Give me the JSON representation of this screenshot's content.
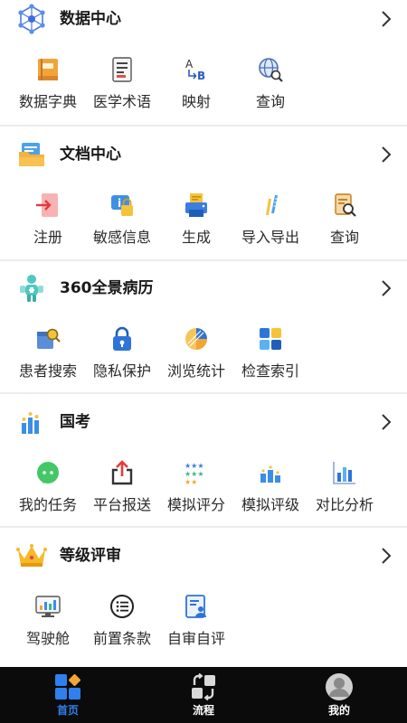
{
  "sections": [
    {
      "title": "数据中心",
      "icon": "network-cube-icon",
      "items": [
        {
          "label": "数据字典",
          "icon": "book-icon"
        },
        {
          "label": "医学术语",
          "icon": "document-list-icon"
        },
        {
          "label": "映射",
          "icon": "ab-mapping-icon"
        },
        {
          "label": "查询",
          "icon": "globe-search-icon"
        }
      ]
    },
    {
      "title": "文档中心",
      "icon": "folder-docs-icon",
      "items": [
        {
          "label": "注册",
          "icon": "login-arrow-icon"
        },
        {
          "label": "敏感信息",
          "icon": "info-lock-icon"
        },
        {
          "label": "生成",
          "icon": "printer-icon"
        },
        {
          "label": "导入导出",
          "icon": "pencil-ruler-icon"
        },
        {
          "label": "查询",
          "icon": "doc-search-icon"
        }
      ]
    },
    {
      "title": "360全景病历",
      "icon": "patient-body-icon",
      "items": [
        {
          "label": "患者搜索",
          "icon": "box-search-icon"
        },
        {
          "label": "隐私保护",
          "icon": "padlock-icon"
        },
        {
          "label": "浏览统计",
          "icon": "pie-chart-icon"
        },
        {
          "label": "检查索引",
          "icon": "blocks-icon"
        }
      ]
    },
    {
      "title": "国考",
      "icon": "bar-chart-icon",
      "items": [
        {
          "label": "我的任务",
          "icon": "chat-bubble-icon"
        },
        {
          "label": "平台报送",
          "icon": "upload-icon"
        },
        {
          "label": "模拟评分",
          "icon": "stars-icon"
        },
        {
          "label": "模拟评级",
          "icon": "ranking-bars-icon"
        },
        {
          "label": "对比分析",
          "icon": "compare-bars-icon"
        }
      ]
    },
    {
      "title": "等级评审",
      "icon": "crown-icon",
      "items": [
        {
          "label": "驾驶舱",
          "icon": "monitor-chart-icon"
        },
        {
          "label": "前置条款",
          "icon": "list-circle-icon"
        },
        {
          "label": "自审自评",
          "icon": "self-review-icon"
        }
      ]
    }
  ],
  "tabs": [
    {
      "label": "首页",
      "icon": "home-tiles-icon",
      "active": true
    },
    {
      "label": "流程",
      "icon": "flow-arrows-icon",
      "active": false
    },
    {
      "label": "我的",
      "icon": "user-icon",
      "active": false
    }
  ],
  "colors": {
    "accent": "#2f80ed",
    "tab_active": "#2f80ed",
    "tab_inactive": "#ffffff",
    "tabbar_bg": "#0b0b0b"
  }
}
